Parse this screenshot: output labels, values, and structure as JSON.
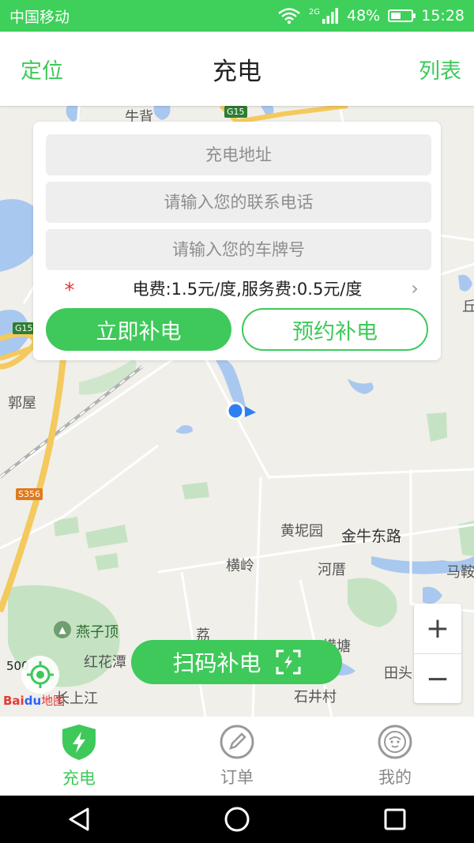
{
  "status_bar": {
    "carrier": "中国移动",
    "network": "2G",
    "battery": "48%",
    "battery_level": 0.48,
    "time": "15:28"
  },
  "nav": {
    "left": "定位",
    "title": "充电",
    "right": "列表"
  },
  "form": {
    "address_placeholder": "充电地址",
    "phone_placeholder": "请输入您的联系电话",
    "plate_placeholder": "请输入您的车牌号",
    "required_mark": "*",
    "fee_text": "电费:1.5元/度,服务费:0.5元/度",
    "fee_chevron": "›",
    "charge_now": "立即补电",
    "reserve": "预约补电"
  },
  "map": {
    "labels": {
      "niubei": "牛背",
      "guowu": "郭屋",
      "huangniyuan": "黄坭园",
      "jinniudonglu": "金牛东路",
      "hengling": "横岭",
      "heceng": "河厝",
      "majing": "马鞍",
      "yanzi": "燕子顶",
      "honghuatan": "红花潭",
      "hengtang": "横塘",
      "tiantou": "田头",
      "changshangjiang": "长上江",
      "shijingcun": "石井村",
      "li": "荔",
      "qiu": "丘"
    },
    "shields": {
      "g15_top": "G15",
      "g15_left": "G15",
      "s356": "S356"
    },
    "scale": "500",
    "logo_bai": "Bai",
    "logo_du": "du",
    "logo_map": "地图"
  },
  "zoom": {
    "in": "+",
    "out": "−"
  },
  "scan_button": "扫码补电",
  "tabs": [
    {
      "label": "充电",
      "icon": "bolt-shield-icon"
    },
    {
      "label": "订单",
      "icon": "pencil-circle-icon"
    },
    {
      "label": "我的",
      "icon": "face-circle-icon"
    }
  ],
  "colors": {
    "brand_green": "#3ec95a",
    "status_green": "#3ed05a"
  }
}
